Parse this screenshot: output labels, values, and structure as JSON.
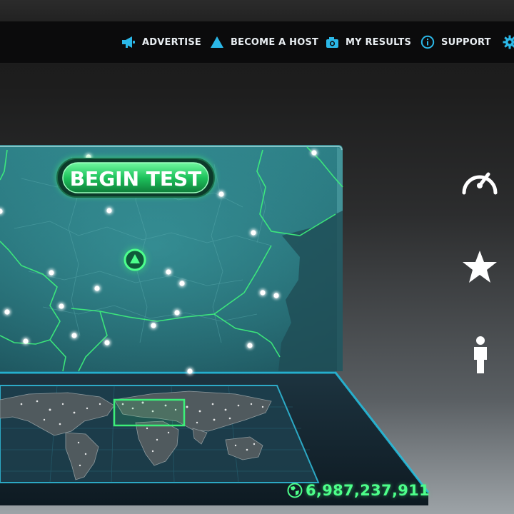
{
  "nav": {
    "items": [
      {
        "label": "ADVERTISE",
        "icon": "megaphone-icon"
      },
      {
        "label": "BECOME A HOST",
        "icon": "triangle-host-icon"
      },
      {
        "label": "MY RESULTS",
        "icon": "camera-results-icon"
      },
      {
        "label": "SUPPORT",
        "icon": "info-icon"
      }
    ],
    "settings_icon": "gear-icon"
  },
  "main": {
    "begin_test_label": "BEGIN TEST",
    "server_count": "6,987,237,911"
  },
  "side_icons": [
    "speedometer-icon",
    "star-icon",
    "person-icon"
  ],
  "colors": {
    "accent_blue": "#2bb8e8",
    "accent_green": "#39f07a",
    "map_teal": "#2d7f86",
    "navbar_bg": "#0b0b0c"
  }
}
